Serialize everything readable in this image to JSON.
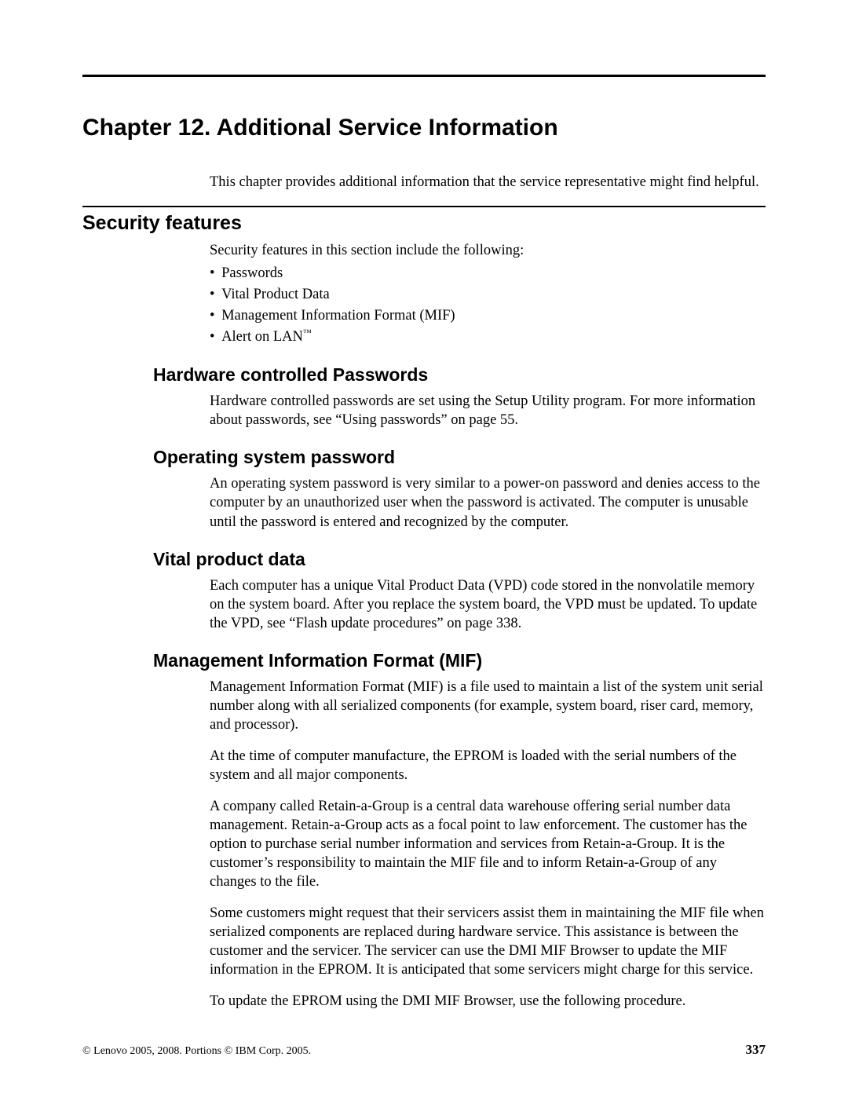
{
  "chapter_title": "Chapter 12. Additional Service Information",
  "intro": "This chapter provides additional information that the service representative might find helpful.",
  "security": {
    "heading": "Security features",
    "intro": "Security features in this section include the following:",
    "bullets": {
      "b0": "Passwords",
      "b1": "Vital Product Data",
      "b2": "Management Information Format (MIF)",
      "b3_prefix": "Alert on LAN",
      "b3_tm": "™"
    }
  },
  "hw_pw": {
    "heading": "Hardware controlled Passwords",
    "para": "Hardware controlled passwords are set using the Setup Utility program. For more information about passwords, see “Using passwords” on page 55."
  },
  "os_pw": {
    "heading": "Operating system password",
    "para": "An operating system password is very similar to a power-on password and denies access to the computer by an unauthorized user when the password is activated. The computer is unusable until the password is entered and recognized by the computer."
  },
  "vpd": {
    "heading": "Vital product data",
    "para": "Each computer has a unique Vital Product Data (VPD) code stored in the nonvolatile memory on the system board. After you replace the system board, the VPD must be updated. To update the VPD, see “Flash update procedures” on page 338."
  },
  "mif": {
    "heading": "Management Information Format (MIF)",
    "p1": "Management Information Format (MIF) is a file used to maintain a list of the system unit serial number along with all serialized components (for example, system board, riser card, memory, and processor).",
    "p2": "At the time of computer manufacture, the EPROM is loaded with the serial numbers of the system and all major components.",
    "p3": "A company called Retain-a-Group is a central data warehouse offering serial number data management. Retain-a-Group acts as a focal point to law enforcement. The customer has the option to purchase serial number information and services from Retain-a-Group. It is the customer’s responsibility to maintain the MIF file and to inform Retain-a-Group of any changes to the file.",
    "p4": "Some customers might request that their servicers assist them in maintaining the MIF file when serialized components are replaced during hardware service. This assistance is between the customer and the servicer. The servicer can use the DMI MIF Browser to update the MIF information in the EPROM. It is anticipated that some servicers might charge for this service.",
    "p5": "To update the EPROM using the DMI MIF Browser, use the following procedure."
  },
  "footer": {
    "copyright": "© Lenovo 2005, 2008. Portions © IBM Corp. 2005.",
    "page": "337"
  }
}
